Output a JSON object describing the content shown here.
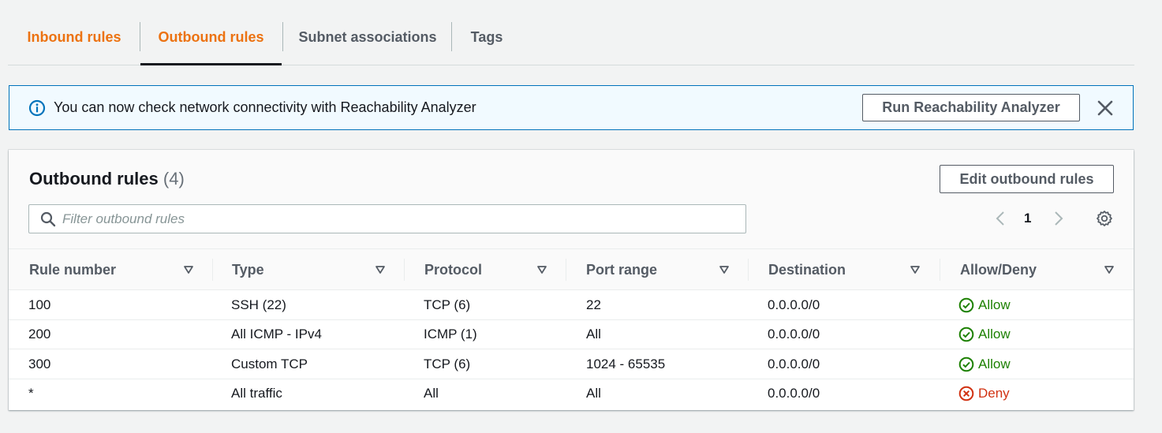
{
  "tabs": [
    {
      "label": "Inbound rules"
    },
    {
      "label": "Outbound rules"
    },
    {
      "label": "Subnet associations"
    },
    {
      "label": "Tags"
    }
  ],
  "banner": {
    "text": "You can now check network connectivity with Reachability Analyzer",
    "button_label": "Run Reachability Analyzer"
  },
  "panel": {
    "title": "Outbound rules",
    "count": "(4)",
    "edit_button": "Edit outbound rules",
    "filter_placeholder": "Filter outbound rules",
    "page": "1"
  },
  "table": {
    "columns": [
      "Rule number",
      "Type",
      "Protocol",
      "Port range",
      "Destination",
      "Allow/Deny"
    ],
    "rows": [
      {
        "rule": "100",
        "type": "SSH (22)",
        "protocol": "TCP (6)",
        "port": "22",
        "destination": "0.0.0.0/0",
        "action": "Allow"
      },
      {
        "rule": "200",
        "type": "All ICMP - IPv4",
        "protocol": "ICMP (1)",
        "port": "All",
        "destination": "0.0.0.0/0",
        "action": "Allow"
      },
      {
        "rule": "300",
        "type": "Custom TCP",
        "protocol": "TCP (6)",
        "port": "1024 - 65535",
        "destination": "0.0.0.0/0",
        "action": "Allow"
      },
      {
        "rule": "*",
        "type": "All traffic",
        "protocol": "All",
        "port": "All",
        "destination": "0.0.0.0/0",
        "action": "Deny"
      }
    ]
  },
  "colors": {
    "accent": "#ec7211",
    "info": "#0073bb",
    "allow": "#1d8102",
    "deny": "#d13212"
  },
  "icons": {
    "info": "info-icon",
    "close": "close-icon",
    "search": "search-icon",
    "prev": "chevron-left-icon",
    "next": "chevron-right-icon",
    "settings": "gear-icon",
    "sort": "sort-caret-icon",
    "allow": "check-circle-icon",
    "deny": "x-circle-icon"
  }
}
